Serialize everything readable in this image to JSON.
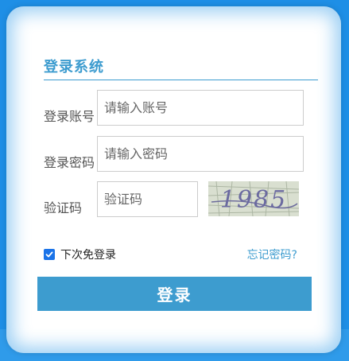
{
  "login": {
    "title": "登录系统",
    "account_label": "登录账号",
    "account_placeholder": "请输入账号",
    "password_label": "登录密码",
    "password_placeholder": "请输入密码",
    "captcha_label": "验证码",
    "captcha_placeholder": "验证码",
    "captcha_text": "1985",
    "remember_label": "下次免登录",
    "remember_checked": true,
    "forgot_label": "忘记密码?",
    "submit_label": "登录"
  },
  "colors": {
    "background": "#1e8fe6",
    "accent": "#3d9ccf",
    "checkbox": "#1a73e8"
  }
}
